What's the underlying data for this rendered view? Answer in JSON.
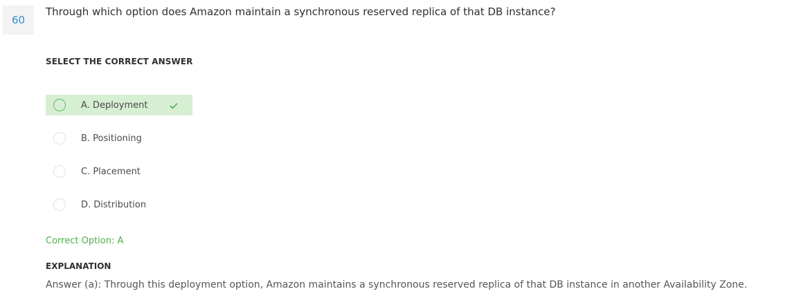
{
  "question": {
    "number": "60",
    "text": "Through which option does Amazon maintain a synchronous reserved replica of that DB instance?"
  },
  "answer_section": {
    "label": "SELECT THE CORRECT ANSWER",
    "options": [
      {
        "label": "A. Deployment",
        "correct": true
      },
      {
        "label": "B. Positioning",
        "correct": false
      },
      {
        "label": "C. Placement",
        "correct": false
      },
      {
        "label": "D. Distribution",
        "correct": false
      }
    ]
  },
  "result": {
    "correct_option": "Correct Option: A"
  },
  "explanation": {
    "label": "EXPLANATION",
    "text": "Answer (a): Through this deployment option, Amazon maintains a synchronous reserved replica of that DB instance in another Availability Zone."
  },
  "colors": {
    "accent_blue": "#2b8fd6",
    "correct_green": "#4cae4c",
    "correct_bg": "#d6efd2"
  },
  "icons": {
    "correct": "checkmark-icon"
  }
}
